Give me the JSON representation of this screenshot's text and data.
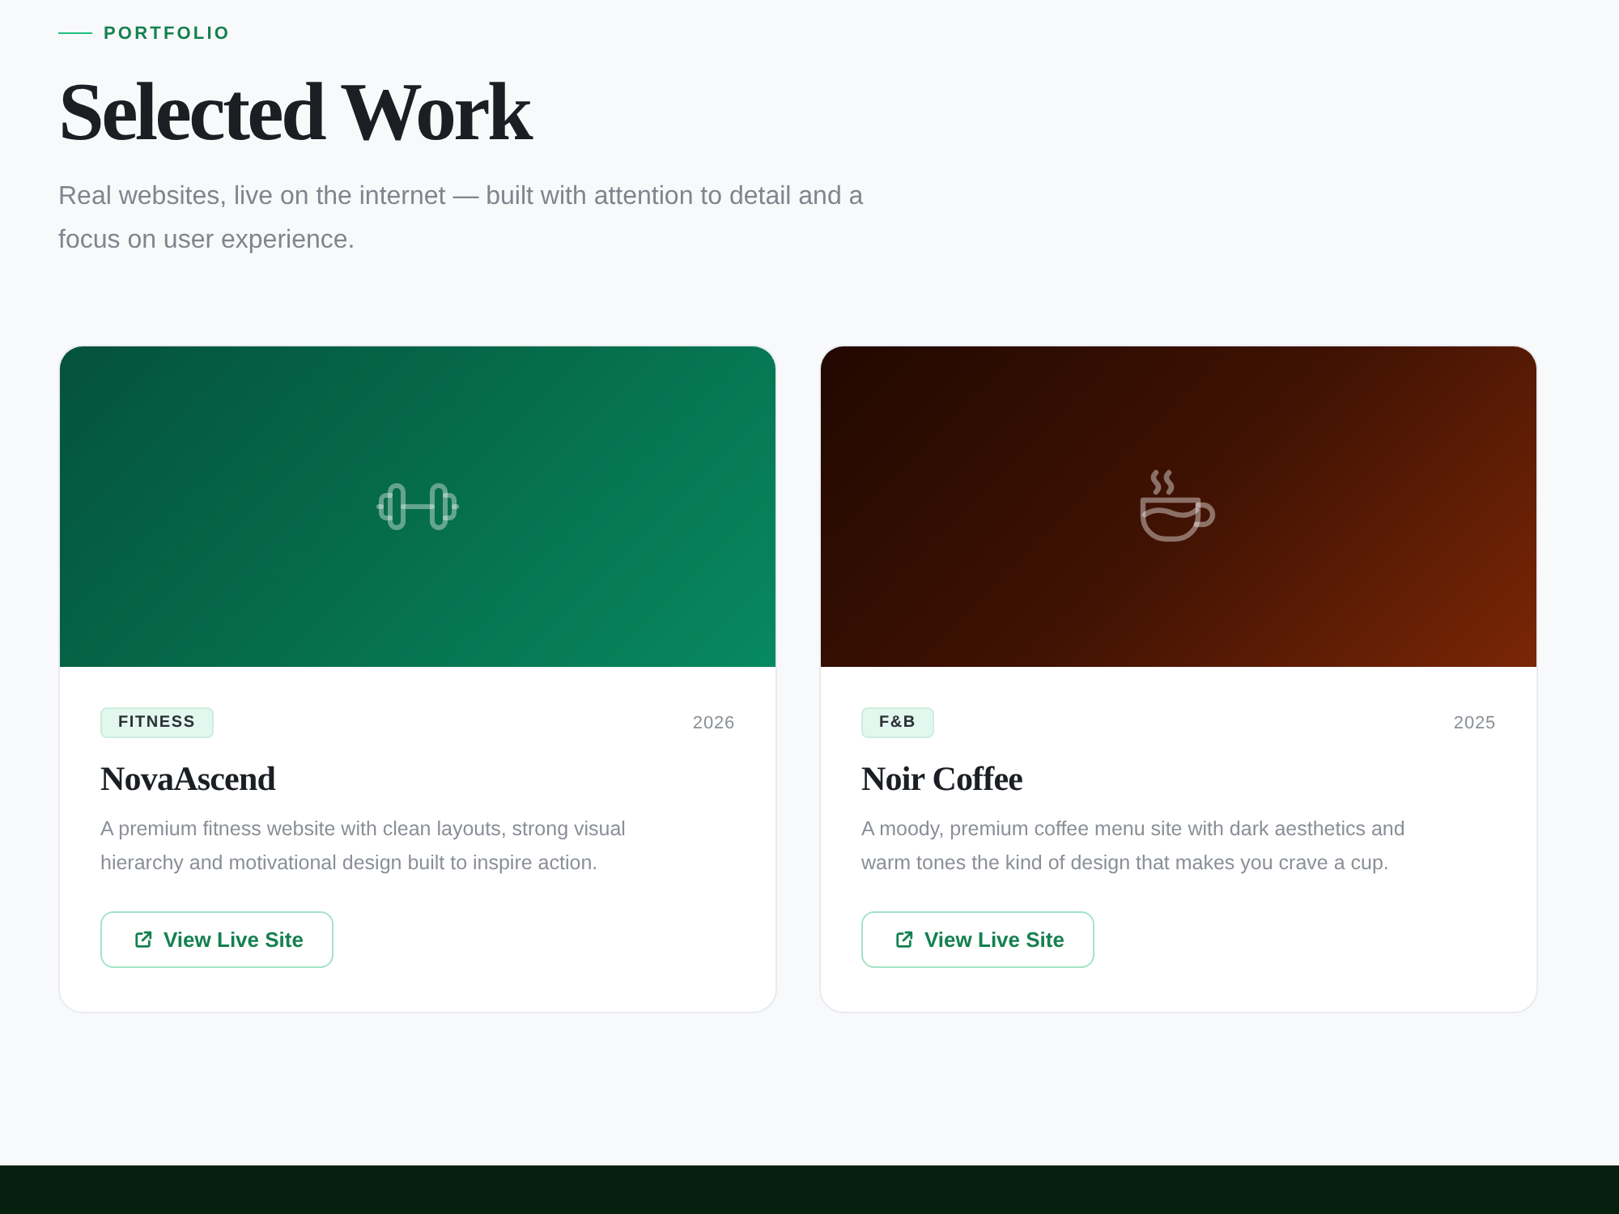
{
  "section": {
    "eyebrow": "PORTFOLIO",
    "title": "Selected Work",
    "subtitle": "Real websites, live on the internet — built with attention to detail and a focus on user experience."
  },
  "projects": [
    {
      "kind": "fitness",
      "tag": "FITNESS",
      "year": "2026",
      "name": "NovaAscend",
      "description": "A premium fitness website with clean layouts, strong visual hierarchy and motivational design built to inspire action.",
      "link_label": "View Live Site"
    },
    {
      "kind": "coffee",
      "tag": "F&B",
      "year": "2025",
      "name": "Noir Coffee",
      "description": "A moody, premium coffee menu site with dark aesthetics and warm tones the kind of design that makes you crave a cup.",
      "link_label": "View Live Site"
    }
  ]
}
